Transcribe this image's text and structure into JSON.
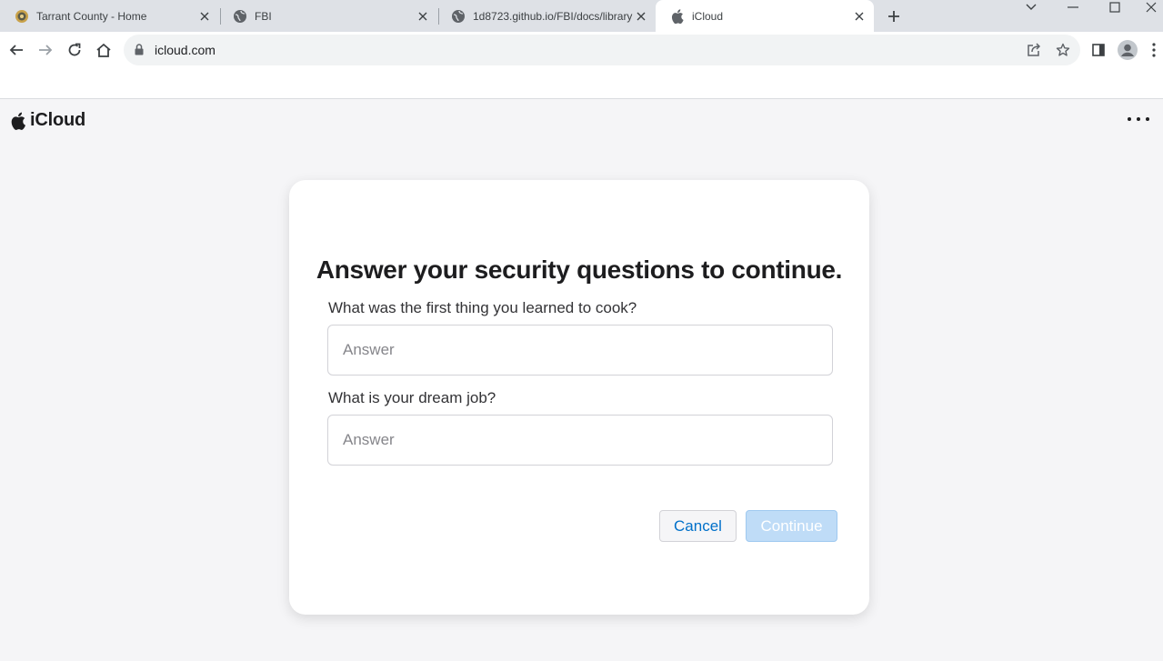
{
  "browser": {
    "tabs": [
      {
        "title": "Tarrant County - Home",
        "icon": "county-seal-icon",
        "active": false
      },
      {
        "title": "FBI",
        "icon": "globe-icon",
        "active": false
      },
      {
        "title": "1d8723.github.io/FBI/docs/library",
        "icon": "globe-icon",
        "active": false
      },
      {
        "title": "iCloud",
        "icon": "apple-icon",
        "active": true
      }
    ],
    "url": "icloud.com"
  },
  "header": {
    "brand_name": "iCloud"
  },
  "form": {
    "heading": "Answer your security questions to continue.",
    "questions": [
      {
        "label": "What was the first thing you learned to cook?",
        "value": "",
        "placeholder": "Answer"
      },
      {
        "label": "What is your dream job?",
        "value": "",
        "placeholder": "Answer"
      }
    ],
    "cancel_label": "Cancel",
    "continue_label": "Continue",
    "continue_enabled": false
  },
  "colors": {
    "accent": "#0070c9",
    "continue_disabled_bg": "#bfdcf7",
    "page_bg": "#f5f5f7",
    "tabstrip_bg": "#dee1e6"
  }
}
